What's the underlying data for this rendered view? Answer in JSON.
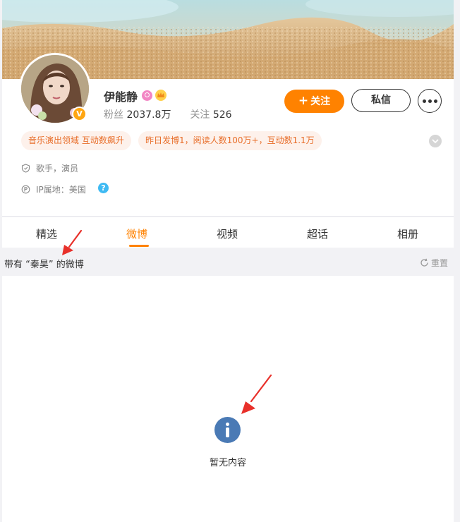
{
  "profile": {
    "name": "伊能静",
    "followers_label": "粉丝",
    "followers_value": "2037.8万",
    "following_label": "关注",
    "following_value": "526",
    "verified_mark": "V"
  },
  "actions": {
    "follow_plus": "+",
    "follow_label": "关注",
    "message_label": "私信"
  },
  "tags": [
    "音乐演出领域 互动数飙升",
    "昨日发博1，阅读人数100万+，互动数1.1万"
  ],
  "info": {
    "occupation": "歌手，演员",
    "ip_location": "IP属地：美国",
    "help_mark": "?"
  },
  "tabs": [
    {
      "label": "精选",
      "active": false
    },
    {
      "label": "微博",
      "active": true
    },
    {
      "label": "视频",
      "active": false
    },
    {
      "label": "超话",
      "active": false
    },
    {
      "label": "相册",
      "active": false
    }
  ],
  "filter": {
    "text": "带有 “秦昊” 的微博",
    "reset_label": "重置"
  },
  "empty_state": {
    "text": "暂无内容"
  },
  "colors": {
    "accent": "#ff8200",
    "tag_bg": "#fdf1eb",
    "tag_text": "#e86e2a",
    "verified": "#ffa612",
    "info_blue": "#4a7ab5",
    "annotation": "#e8302a"
  },
  "icons": {
    "occupation": "shield-icon",
    "ip": "location-icon",
    "help": "question-icon",
    "reset": "refresh-icon",
    "empty": "info-icon",
    "collapse": "chevron-down-icon",
    "more": "more-dots-icon"
  }
}
